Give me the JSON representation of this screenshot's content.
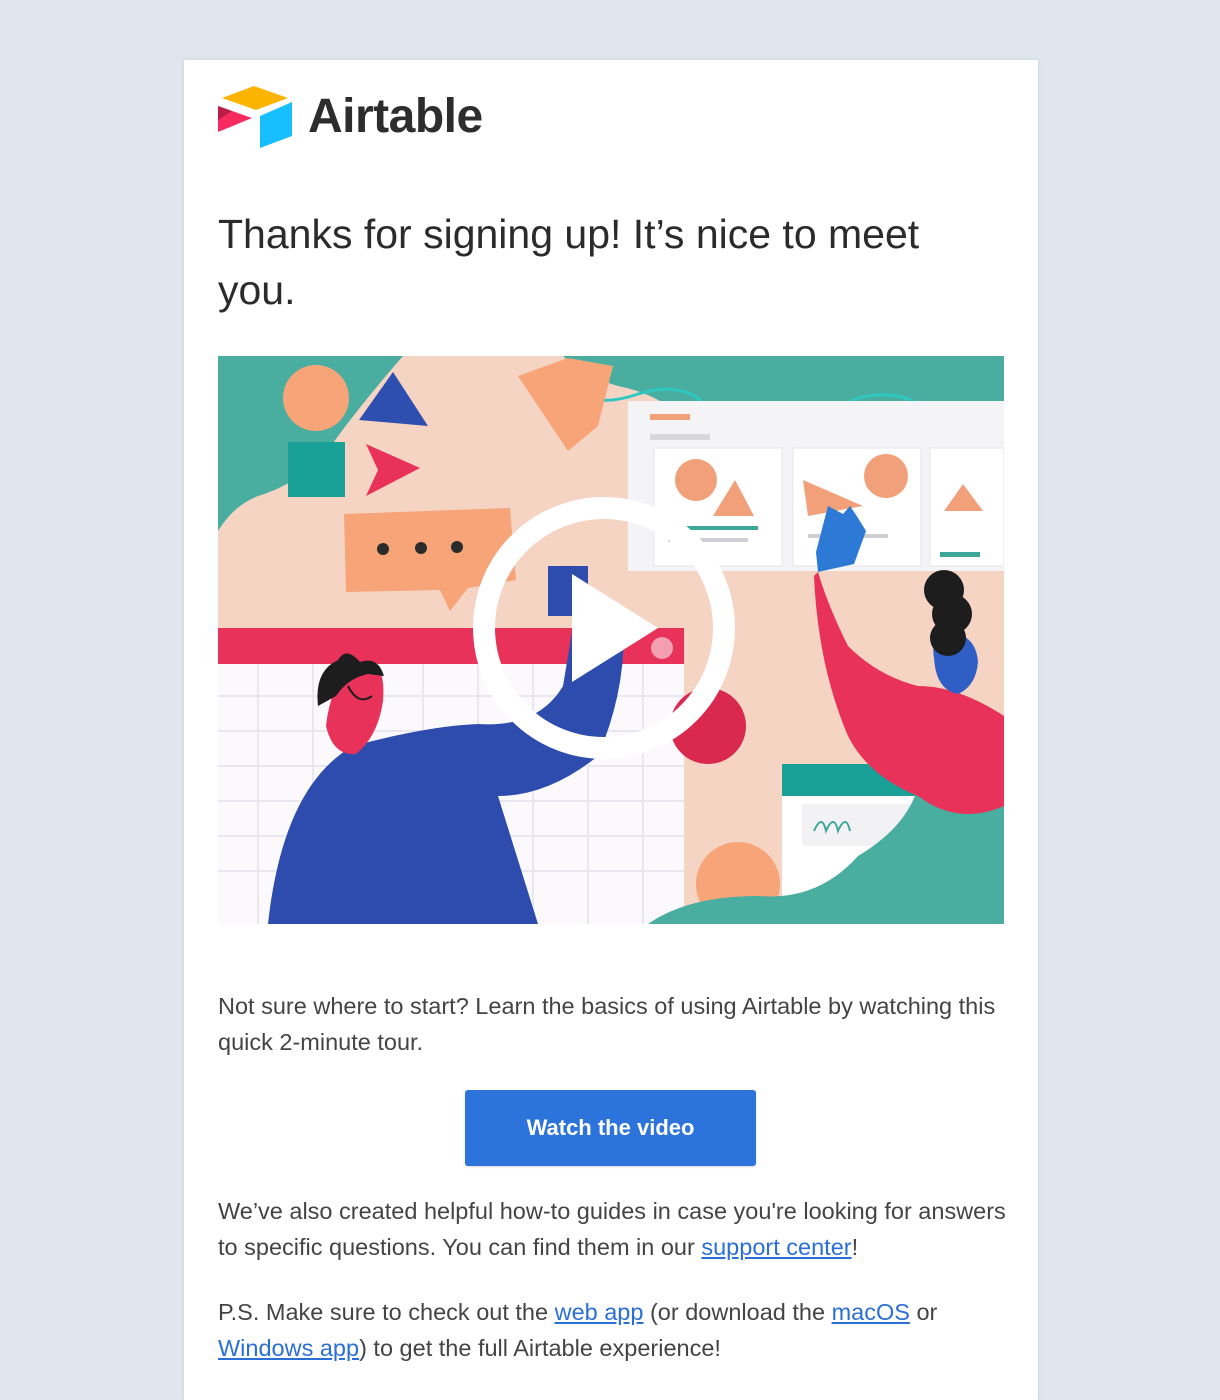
{
  "brand": {
    "name": "Airtable"
  },
  "headline": "Thanks for signing up! It’s nice to meet you.",
  "hero": {
    "media": "video-thumbnail",
    "overlay_icon": "play-icon"
  },
  "intro": "Not sure where to start? Learn the basics of using Airtable by watching this quick 2-minute tour.",
  "cta": {
    "label": "Watch the video",
    "color": "#2d73dc"
  },
  "guides": {
    "text_before": "We’ve also created helpful how-to guides in case you're looking for answers to specific questions. You can find them in our ",
    "link": "support center",
    "text_after": "!"
  },
  "ps": {
    "text1": "P.S. Make sure to check out the ",
    "link1": "web app",
    "text2": " (or download the ",
    "link2": "macOS",
    "text3": " or ",
    "link3": "Windows app",
    "text4": ") to get the full Airtable experience!"
  },
  "colors": {
    "background": "#dfe6ee",
    "link": "#2a6fd6",
    "teal": "#3fa79a",
    "peach": "#f6d4c4",
    "pink": "#e8325a",
    "blue": "#2f4fb0"
  }
}
